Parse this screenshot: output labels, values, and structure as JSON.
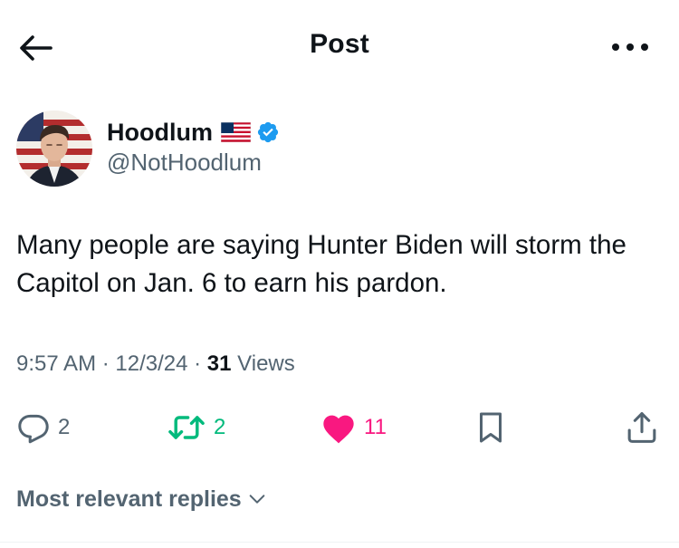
{
  "header": {
    "title": "Post"
  },
  "author": {
    "name": "Hoodlum",
    "handle": "@NotHoodlum",
    "flag_icon": "us-flag-icon",
    "verified_icon": "verified-badge-icon",
    "verified_color": "#1d9bf0"
  },
  "tweet": {
    "text": "Many people are saying Hunter Biden will storm the Capitol on Jan. 6 to earn his pardon."
  },
  "meta": {
    "time": "9:57 AM",
    "separator": " · ",
    "date": "12/3/24",
    "views_count": "31",
    "views_label": "Views"
  },
  "actions": {
    "replies": "2",
    "reposts": "2",
    "likes": "11",
    "repost_color": "#00ba7c",
    "like_color": "#f91880"
  },
  "replies_sort": {
    "label": "Most relevant replies"
  }
}
